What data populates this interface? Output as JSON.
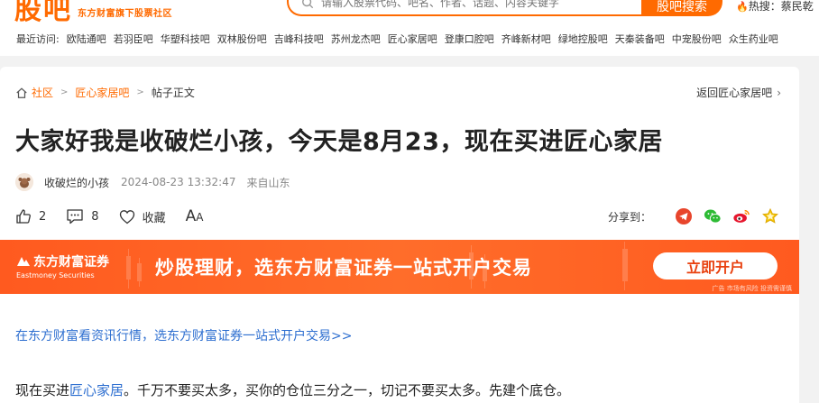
{
  "header": {
    "logo_text": "股吧",
    "logo_sub": "东方财富旗下股票社区",
    "search_placeholder": "请输入股票代码、吧名、作者、话题、内容关键字",
    "search_button": "股吧搜索",
    "hot_label": "热搜：",
    "hot_text": "蔡民乾"
  },
  "recent": {
    "label": "最近访问:",
    "links": [
      "欧陆通吧",
      "若羽臣吧",
      "华塑科技吧",
      "双林股份吧",
      "吉峰科技吧",
      "苏州龙杰吧",
      "匠心家居吧",
      "登康口腔吧",
      "齐峰新材吧",
      "绿地控股吧",
      "天秦装备吧",
      "中宠股份吧",
      "众生药业吧"
    ]
  },
  "breadcrumb": {
    "items": [
      "社区",
      "匠心家居吧",
      "帖子正文"
    ]
  },
  "back_link": "返回匠心家居吧",
  "post": {
    "title": "大家好我是收破烂小孩，今天是8月23，现在买进匠心家居",
    "author": "收破烂的小孩",
    "time": "2024-08-23 13:32:47",
    "location": "来自山东",
    "likes": "2",
    "comments": "8",
    "collect_label": "收藏",
    "font_big": "A",
    "font_small": "A"
  },
  "share": {
    "label": "分享到：",
    "icons": [
      "telegram-share-icon",
      "wechat-share-icon",
      "weibo-share-icon",
      "favorite-star-icon"
    ]
  },
  "banner": {
    "logo_cn": "东方财富证券",
    "logo_en": "Eastmoney Securities",
    "text": "炒股理财，选东方财富证券一站式开户交易",
    "button": "立即开户",
    "note": "广告 市场有风险 投资需谨慎"
  },
  "promo_link": "在东方财富看资讯行情，选东方财富证券一站式开户交易>>",
  "content": {
    "prefix": "现在买进",
    "link": "匠心家居",
    "suffix": "。千万不要买太多，买你的仓位三分之一，切记不要买太多。先建个底仓。"
  },
  "colors": {
    "accent": "#ff6a00",
    "link": "#2e6fd0",
    "banner": "#ff5a1f"
  }
}
